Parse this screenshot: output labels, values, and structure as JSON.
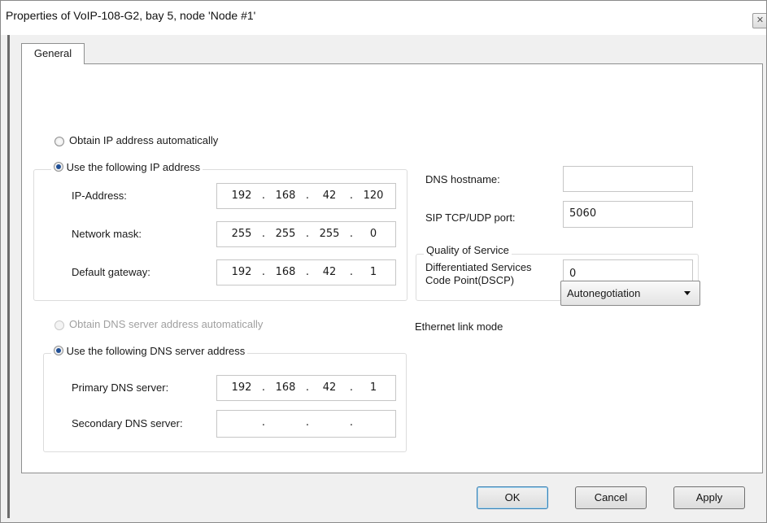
{
  "window": {
    "title": "Properties of VoIP-108-G2, bay 5, node 'Node #1'",
    "close_glyph": "✕"
  },
  "tabs": [
    {
      "label": "General",
      "selected": true
    }
  ],
  "ip_section": {
    "obtain_auto_label": "Obtain IP address automatically",
    "obtain_auto_checked": false,
    "use_following_label": "Use the following IP address",
    "use_following_checked": true,
    "ip_address": {
      "label": "IP-Address:",
      "octets": [
        "192",
        "168",
        "42",
        "120"
      ]
    },
    "network_mask": {
      "label": "Network mask:",
      "octets": [
        "255",
        "255",
        "255",
        "0"
      ]
    },
    "default_gateway": {
      "label": "Default gateway:",
      "octets": [
        "192",
        "168",
        "42",
        "1"
      ]
    }
  },
  "dns_section": {
    "obtain_auto_label": "Obtain DNS server address automatically",
    "obtain_auto_disabled": true,
    "use_following_label": "Use the following DNS server address",
    "use_following_checked": true,
    "primary": {
      "label": "Primary DNS server:",
      "octets": [
        "192",
        "168",
        "42",
        "1"
      ]
    },
    "secondary": {
      "label": "Secondary DNS server:",
      "octets": [
        "",
        "",
        "",
        ""
      ]
    }
  },
  "right_panel": {
    "dns_hostname": {
      "label": "DNS hostname:",
      "value": ""
    },
    "sip_port": {
      "label": "SIP TCP/UDP port:",
      "value": "5060"
    },
    "qos": {
      "title": "Quality of Service",
      "dscp_label_line1": "Differentiated Services",
      "dscp_label_line2": "Code Point(DSCP)",
      "dscp_value": "0"
    },
    "ethernet_link_mode": {
      "label": "Ethernet link mode",
      "selected": "Autonegotiation"
    }
  },
  "buttons": {
    "ok": "OK",
    "cancel": "Cancel",
    "apply": "Apply"
  },
  "icons": {
    "close": "close-icon",
    "dropdown": "chevron-down-icon"
  },
  "colors": {
    "window_bg": "#f0f0f0",
    "panel_bg": "#ffffff",
    "radio_dot": "#1f4f96",
    "default_button_border": "#3c7fb1",
    "disabled_text": "#a0a0a0"
  }
}
